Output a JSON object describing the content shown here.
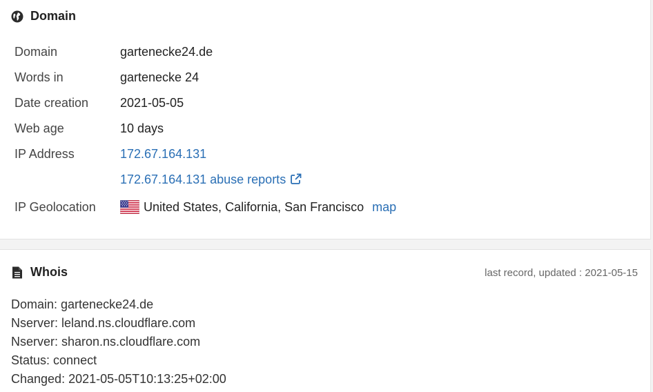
{
  "domain_section": {
    "title": "Domain",
    "rows": [
      {
        "label": "Domain",
        "value": "gartenecke24.de"
      },
      {
        "label": "Words in",
        "value": "gartenecke 24"
      },
      {
        "label": "Date creation",
        "value": "2021-05-05"
      },
      {
        "label": "Web age",
        "value": "10 days"
      },
      {
        "label": "IP Address",
        "value": "172.67.164.131"
      },
      {
        "label": "",
        "value": "172.67.164.131 abuse reports"
      },
      {
        "label": "IP Geolocation",
        "value": "United States, California, San Francisco",
        "link": "map"
      }
    ],
    "link_color": "#2a6fb5"
  },
  "whois_section": {
    "title": "Whois",
    "updated": "last record, updated : 2021-05-15",
    "lines": [
      "Domain: gartenecke24.de",
      "Nserver: leland.ns.cloudflare.com",
      "Nserver: sharon.ns.cloudflare.com",
      "Status: connect",
      "Changed: 2021-05-05T10:13:25+02:00"
    ]
  },
  "icons": {
    "domain": "globe-icon",
    "whois": "document-icon",
    "abuse": "external-link-icon",
    "flag": "us-flag-icon"
  }
}
